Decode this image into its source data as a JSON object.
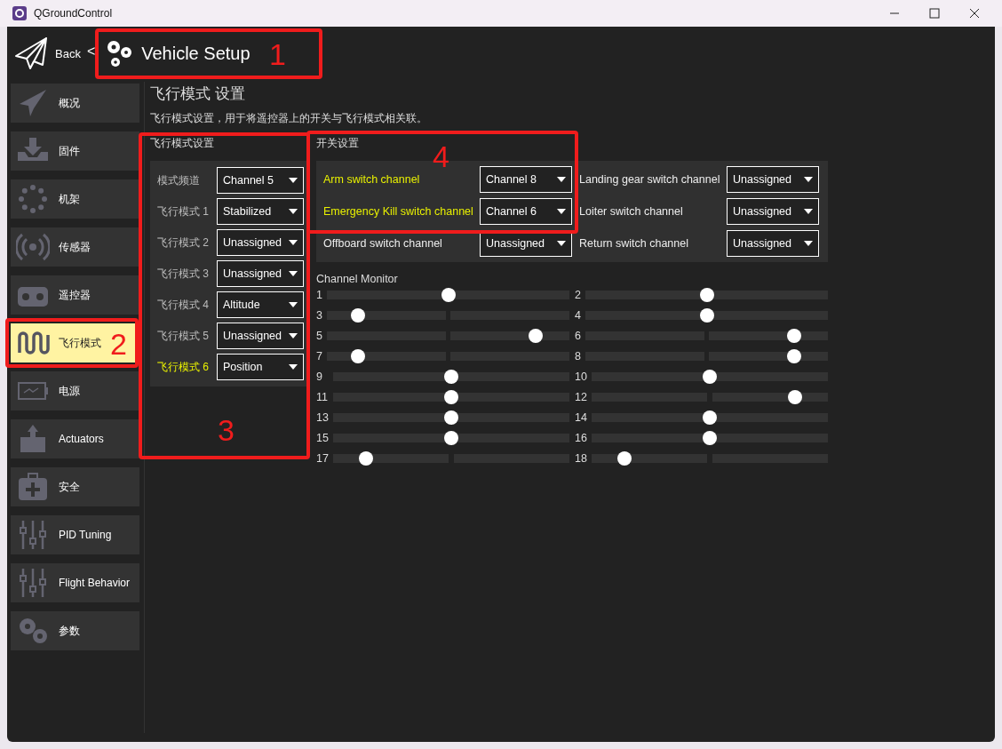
{
  "window": {
    "title": "QGroundControl"
  },
  "header": {
    "back": "Back",
    "separator": "<",
    "title": "Vehicle Setup"
  },
  "sidebar": {
    "items": [
      {
        "kind": "plane",
        "label": "概况",
        "selected": false
      },
      {
        "kind": "download",
        "label": "固件",
        "selected": false
      },
      {
        "kind": "dots",
        "label": "机架",
        "selected": false
      },
      {
        "kind": "radio",
        "label": "传感器",
        "selected": false
      },
      {
        "kind": "remote",
        "label": "遥控器",
        "selected": false
      },
      {
        "kind": "wave",
        "label": "飞行模式",
        "selected": true
      },
      {
        "kind": "battery",
        "label": "电源",
        "selected": false
      },
      {
        "kind": "actuator",
        "label": "Actuators",
        "selected": false
      },
      {
        "kind": "medkit",
        "label": "安全",
        "selected": false
      },
      {
        "kind": "sliders",
        "label": "PID Tuning",
        "selected": false
      },
      {
        "kind": "sliders",
        "label": "Flight Behavior",
        "selected": false
      },
      {
        "kind": "gears",
        "label": "参数",
        "selected": false
      }
    ]
  },
  "page": {
    "title": "飞行模式 设置",
    "description": "飞行模式设置，用于将遥控器上的开关与飞行模式相关联。"
  },
  "flight_modes": {
    "title": "飞行模式设置",
    "rows": [
      {
        "label": "模式频道",
        "value": "Channel 5",
        "active": false
      },
      {
        "label": "飞行模式 1",
        "value": "Stabilized",
        "active": false
      },
      {
        "label": "飞行模式 2",
        "value": "Unassigned",
        "active": false
      },
      {
        "label": "飞行模式 3",
        "value": "Unassigned",
        "active": false
      },
      {
        "label": "飞行模式 4",
        "value": "Altitude",
        "active": false
      },
      {
        "label": "飞行模式 5",
        "value": "Unassigned",
        "active": false
      },
      {
        "label": "飞行模式 6",
        "value": "Position",
        "active": true
      }
    ]
  },
  "switches": {
    "title": "开关设置",
    "items": [
      {
        "label": "Arm switch channel",
        "value": "Channel 8",
        "active": true
      },
      {
        "label": "Landing gear switch channel",
        "value": "Unassigned",
        "active": false
      },
      {
        "label": "Emergency Kill switch channel",
        "value": "Channel 6",
        "active": true
      },
      {
        "label": "Loiter switch channel",
        "value": "Unassigned",
        "active": false
      },
      {
        "label": "Offboard switch channel",
        "value": "Unassigned",
        "active": false
      },
      {
        "label": "Return switch channel",
        "value": "Unassigned",
        "active": false
      }
    ]
  },
  "channel_monitor": {
    "title": "Channel Monitor",
    "channels": [
      {
        "number": "1",
        "level": 0.5
      },
      {
        "number": "2",
        "level": 0.5
      },
      {
        "number": "3",
        "level": 0.13
      },
      {
        "number": "4",
        "level": 0.5
      },
      {
        "number": "5",
        "level": 0.86
      },
      {
        "number": "6",
        "level": 0.86
      },
      {
        "number": "7",
        "level": 0.13
      },
      {
        "number": "8",
        "level": 0.86
      },
      {
        "number": "9",
        "level": 0.5
      },
      {
        "number": "10",
        "level": 0.5
      },
      {
        "number": "11",
        "level": 0.5
      },
      {
        "number": "12",
        "level": 0.86
      },
      {
        "number": "13",
        "level": 0.5
      },
      {
        "number": "14",
        "level": 0.5
      },
      {
        "number": "15",
        "level": 0.5
      },
      {
        "number": "16",
        "level": 0.5
      },
      {
        "number": "17",
        "level": 0.14
      },
      {
        "number": "18",
        "level": 0.14
      }
    ]
  },
  "annotations": [
    {
      "number": "1"
    },
    {
      "number": "2"
    },
    {
      "number": "3"
    },
    {
      "number": "4"
    }
  ]
}
